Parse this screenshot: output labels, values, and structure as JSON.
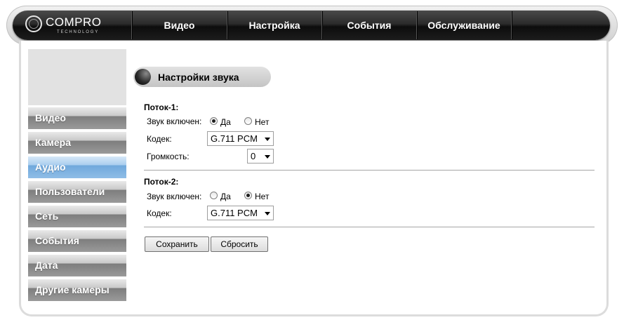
{
  "brand": {
    "name": "COMPRO",
    "sub": "TECHNOLOGY"
  },
  "nav": [
    {
      "label": "Видео"
    },
    {
      "label": "Настройка"
    },
    {
      "label": "События"
    },
    {
      "label": "Обслуживание"
    }
  ],
  "sidebar": [
    {
      "label": "Видео",
      "active": false
    },
    {
      "label": "Камера",
      "active": false
    },
    {
      "label": "Аудио",
      "active": true
    },
    {
      "label": "Пользователи",
      "active": false
    },
    {
      "label": "Сеть",
      "active": false
    },
    {
      "label": "События",
      "active": false
    },
    {
      "label": "Дата",
      "active": false
    },
    {
      "label": "Другие камеры",
      "active": false
    }
  ],
  "section_title": "Настройки звука",
  "stream1": {
    "title": "Поток-1:",
    "audio_enabled_label": "Звук включен:",
    "yes": "Да",
    "no": "Нет",
    "audio_enabled": "yes",
    "codec_label": "Кодек:",
    "codec_value": "G.711 PCM",
    "volume_label": "Громкость:",
    "volume_value": "0"
  },
  "stream2": {
    "title": "Поток-2:",
    "audio_enabled_label": "Звук включен:",
    "yes": "Да",
    "no": "Нет",
    "audio_enabled": "no",
    "codec_label": "Кодек:",
    "codec_value": "G.711 PCM"
  },
  "buttons": {
    "save": "Сохранить",
    "reset": "Сбросить"
  },
  "colors": {
    "active_menu": "#6fa8dc",
    "topbar": "#1c1c1c"
  }
}
